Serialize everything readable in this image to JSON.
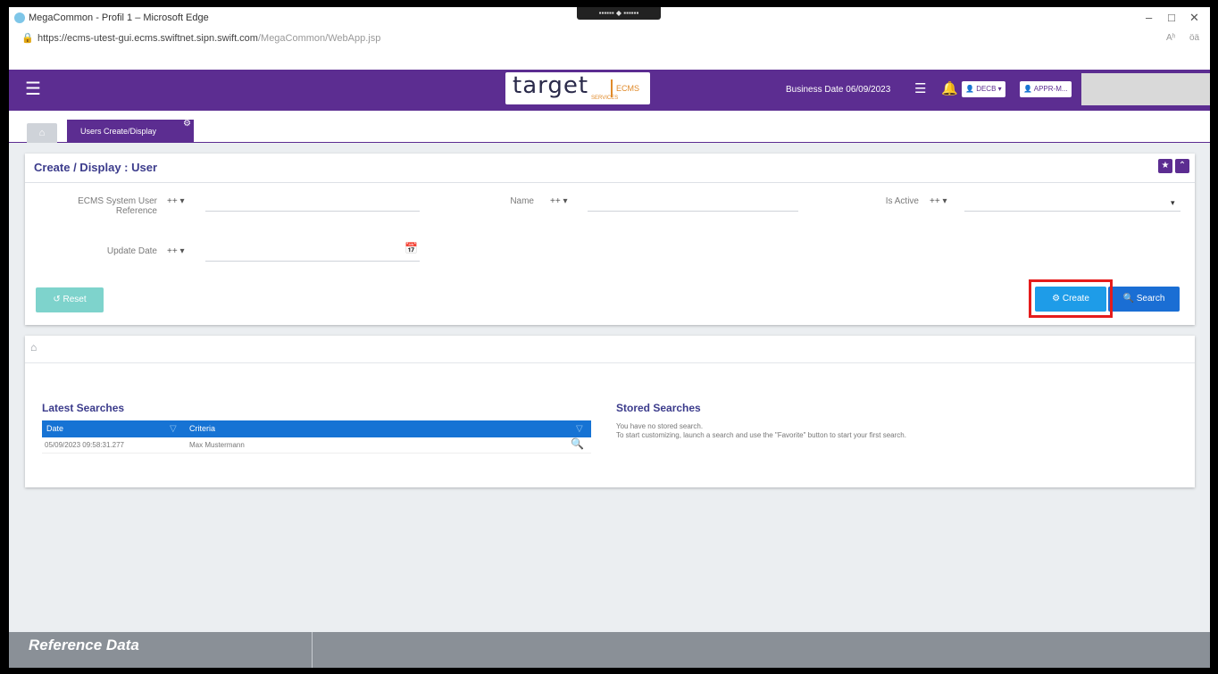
{
  "browser": {
    "window_title": "MegaCommon - Profil 1 – Microsoft Edge",
    "url_main": "https://ecms-utest-gui.ecms.swiftnet.sipn.swift.com",
    "url_path": "/MegaCommon/WebApp.jsp",
    "minimize": "–",
    "restore": "□",
    "close": "✕",
    "read_aloud": "Aʰ",
    "favorites_label": "öä"
  },
  "header": {
    "logo_text": "target",
    "logo_subtext": "SERVICES",
    "logo_ecms": "ECMS",
    "business_date": "Business Date 06/09/2023",
    "user_dropdown": "DECB",
    "role_dropdown": "APPR-M..."
  },
  "tabs": {
    "active": "Users Create/Display"
  },
  "form": {
    "title": "Create / Display : User",
    "fields": [
      {
        "label_1": "ECMS System User",
        "label_2": "Reference",
        "operator": "++"
      },
      {
        "label": "Name",
        "operator": "++"
      },
      {
        "label": "Is Active",
        "operator": "++"
      },
      {
        "label": "Update Date",
        "operator": "++"
      }
    ],
    "reset_label": "Reset",
    "create_label": "Create",
    "search_label": "Search"
  },
  "latest_searches": {
    "title": "Latest Searches",
    "columns": [
      "Date",
      "Criteria"
    ],
    "rows": [
      {
        "date": "05/09/2023 09:58:31.277",
        "criteria": "Max Mustermann"
      }
    ]
  },
  "stored_searches": {
    "title": "Stored Searches",
    "line1": "You have no stored search.",
    "line2": "To start customizing, launch a search and use the \"Favorite\" button to start your first search."
  },
  "footer": {
    "title": "Reference Data"
  },
  "colors": {
    "brand_purple": "#5c2d91",
    "create_blue": "#1e9ce8",
    "search_blue": "#1a6ed4",
    "highlight_red": "#e51c1c"
  }
}
